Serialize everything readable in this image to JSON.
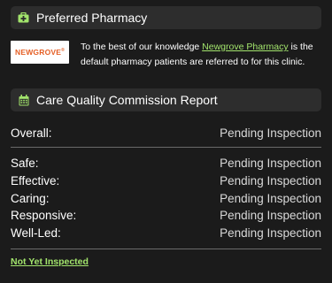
{
  "pharmacy": {
    "header_title": "Preferred Pharmacy",
    "logo_text": "NEWGROVE",
    "logo_mark": "®",
    "text_before": "To the best of our knowledge ",
    "link_text": "Newgrove Pharmacy",
    "text_after": " is the default pharmacy patients are referred to for this clinic."
  },
  "cqc": {
    "header_title": "Care Quality Commission Report",
    "overall": {
      "label": "Overall:",
      "value": "Pending Inspection"
    },
    "ratings": [
      {
        "label": "Safe:",
        "value": "Pending Inspection"
      },
      {
        "label": "Effective:",
        "value": "Pending Inspection"
      },
      {
        "label": "Caring:",
        "value": "Pending Inspection"
      },
      {
        "label": "Responsive:",
        "value": "Pending Inspection"
      },
      {
        "label": "Well-Led:",
        "value": "Pending Inspection"
      }
    ],
    "footer_link": "Not Yet Inspected"
  },
  "colors": {
    "background": "#1b1b1b",
    "header_bg": "#2d2d2d",
    "accent_green": "#a2e46c",
    "logo_orange": "#e55f25"
  },
  "icons": {
    "pharmacy": "medical-bag-icon",
    "report": "calendar-icon"
  }
}
